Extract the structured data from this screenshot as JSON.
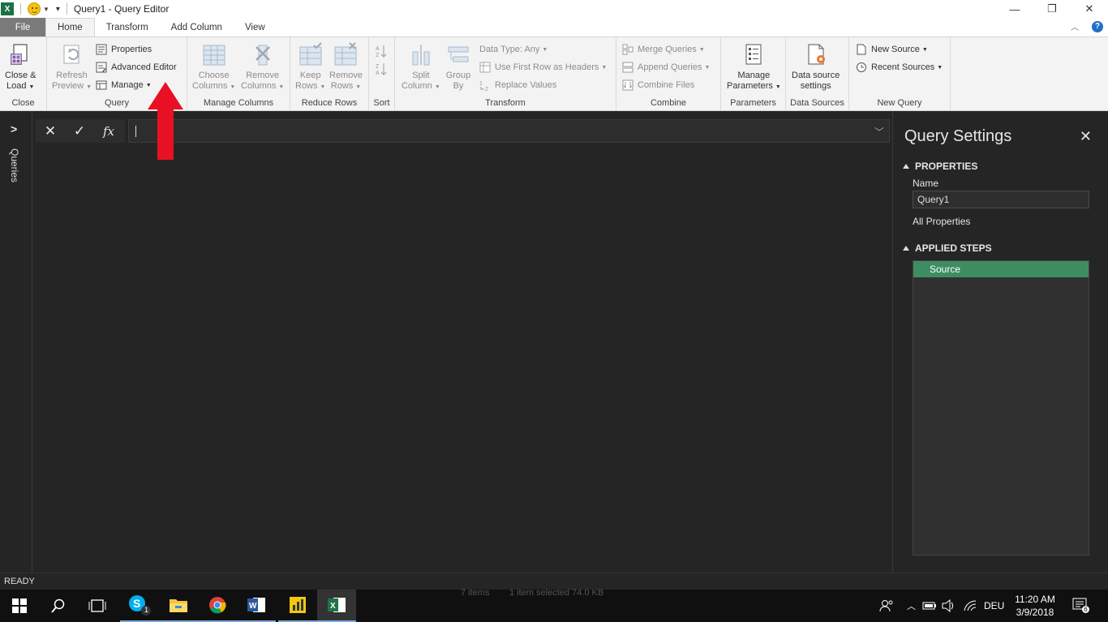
{
  "window": {
    "title": "Query1 - Query Editor",
    "app_icon_letter": "X",
    "minimize": "—",
    "restore": "❐",
    "close": "✕"
  },
  "tabs": {
    "file": "File",
    "home": "Home",
    "transform": "Transform",
    "add_column": "Add Column",
    "view": "View"
  },
  "help": "?",
  "ribbon": {
    "close": {
      "close_load_line1": "Close &",
      "close_load_line2": "Load",
      "label": "Close"
    },
    "query": {
      "refresh_line1": "Refresh",
      "refresh_line2": "Preview",
      "properties": "Properties",
      "advanced_editor": "Advanced Editor",
      "manage": "Manage",
      "label": "Query"
    },
    "manage_columns": {
      "choose_line1": "Choose",
      "choose_line2": "Columns",
      "remove_line1": "Remove",
      "remove_line2": "Columns",
      "label": "Manage Columns"
    },
    "reduce_rows": {
      "keep_line1": "Keep",
      "keep_line2": "Rows",
      "remove_line1": "Remove",
      "remove_line2": "Rows",
      "label": "Reduce Rows"
    },
    "sort": {
      "label": "Sort"
    },
    "transform": {
      "split_line1": "Split",
      "split_line2": "Column",
      "group_line1": "Group",
      "group_line2": "By",
      "data_type": "Data Type: Any",
      "first_row": "Use First Row as Headers",
      "replace": "Replace Values",
      "label": "Transform"
    },
    "combine": {
      "merge": "Merge Queries",
      "append": "Append Queries",
      "combine_files": "Combine Files",
      "label": "Combine"
    },
    "parameters": {
      "manage_line1": "Manage",
      "manage_line2": "Parameters",
      "label": "Parameters"
    },
    "data_sources": {
      "settings_line1": "Data source",
      "settings_line2": "settings",
      "label": "Data Sources"
    },
    "new_query": {
      "new_source": "New Source",
      "recent_sources": "Recent Sources",
      "label": "New Query"
    }
  },
  "queries_pane": {
    "label": "Queries"
  },
  "query_settings": {
    "title": "Query Settings",
    "properties_header": "PROPERTIES",
    "name_label": "Name",
    "name_value": "Query1",
    "all_properties": "All Properties",
    "applied_steps_header": "APPLIED STEPS",
    "steps": [
      "Source"
    ]
  },
  "status": {
    "text": "READY"
  },
  "taskbar": {
    "behind_items": "7 items",
    "behind_selected": "1 item selected  74.0 KB",
    "skype_badge": "1",
    "language": "DEU",
    "time": "11:20 AM",
    "date": "3/9/2018",
    "notifications": "6"
  },
  "colors": {
    "accent_green": "#3e8d62",
    "arrow_red": "#e81123",
    "dark_bg": "#252525"
  }
}
